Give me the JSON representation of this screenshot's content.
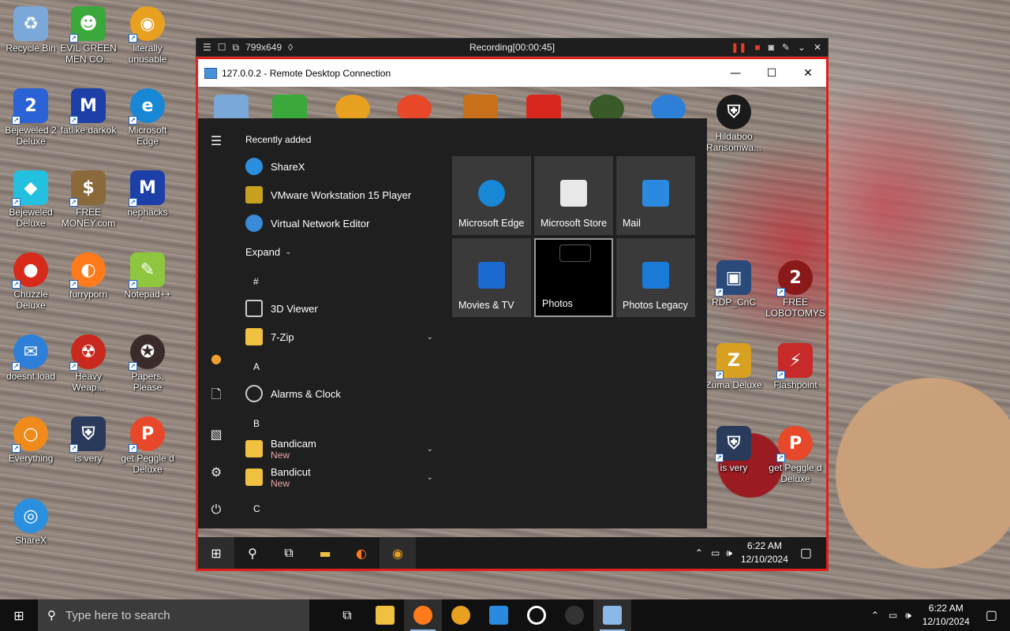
{
  "desktop": {
    "icons": [
      {
        "label": "Recycle Bin",
        "color": "#7aa8d8"
      },
      {
        "label": "EVIL GREEN MEN CO...",
        "color": "#3aa83a"
      },
      {
        "label": "literally unusable",
        "color": "#e8a020"
      },
      {
        "label": "Bejeweled 2 Deluxe",
        "color": "#2b62d6"
      },
      {
        "label": "fatlike darkok",
        "color": "#1c3fa8"
      },
      {
        "label": "Microsoft Edge",
        "color": "#1787d6"
      },
      {
        "label": "Bejeweled Deluxe",
        "color": "#23c0e0"
      },
      {
        "label": "FREE MONEY.com",
        "color": "#8a6a3a"
      },
      {
        "label": "nephacks",
        "color": "#1c3fa8"
      },
      {
        "label": "Chuzzle Deluxe",
        "color": "#d82a1a"
      },
      {
        "label": "furryporn",
        "color": "#ff7a1a"
      },
      {
        "label": "Notepad++",
        "color": "#8ec63f"
      },
      {
        "label": "doesnt load",
        "color": "#2d7fd8"
      },
      {
        "label": "Heavy Weap...",
        "color": "#c8281e"
      },
      {
        "label": "Papers, Please",
        "color": "#3a2a2a"
      },
      {
        "label": "Everything",
        "color": "#f08a1a"
      },
      {
        "label": "is very",
        "color": "#2a3a5a"
      },
      {
        "label": "get Peggle d Deluxe",
        "color": "#e8482a"
      },
      {
        "label": "ShareX",
        "color": "#2b8fe0"
      }
    ]
  },
  "recorder": {
    "size_label": "799x649",
    "status": "Recording[00:00:45]"
  },
  "rdp": {
    "window_title": "127.0.0.2 - Remote Desktop Connection",
    "minimize_glyph": "—",
    "maximize_glyph": "☐",
    "close_glyph": "✕",
    "desktop_icons": [
      {
        "label": "Hildaboo Ransomwa...",
        "color": "#1a1a1a"
      },
      {
        "label": "RDP_CnC",
        "color": "#2a4a7a"
      },
      {
        "label": "FREE LOBOTOMYS",
        "color": "#8a1a1a"
      },
      {
        "label": "Zuma Deluxe",
        "color": "#d8a020"
      },
      {
        "label": "Flashpoint",
        "color": "#c82a2a"
      },
      {
        "label": "is very",
        "color": "#2a3a5a"
      },
      {
        "label": "get Peggle d Deluxe",
        "color": "#e8482a"
      }
    ]
  },
  "start_menu": {
    "recently_added_label": "Recently added",
    "recent": [
      {
        "label": "ShareX",
        "color": "#2b8fe0"
      },
      {
        "label": "VMware Workstation 15 Player",
        "color": "#c8a020"
      },
      {
        "label": "Virtual Network Editor",
        "color": "#3a8ad8"
      }
    ],
    "expand_label": "Expand",
    "groups": [
      {
        "letter": "#",
        "items": [
          {
            "label": "3D Viewer",
            "color": "#555555",
            "new": "",
            "chevron": ""
          },
          {
            "label": "7-Zip",
            "color": "#f0c040",
            "new": "",
            "chevron": "⌄"
          }
        ]
      },
      {
        "letter": "A",
        "items": [
          {
            "label": "Alarms & Clock",
            "color": "#555555",
            "new": "",
            "chevron": ""
          }
        ]
      },
      {
        "letter": "B",
        "items": [
          {
            "label": "Bandicam",
            "color": "#f0c040",
            "new": "New",
            "chevron": "⌄"
          },
          {
            "label": "Bandicut",
            "color": "#f0c040",
            "new": "New",
            "chevron": "⌄"
          }
        ]
      },
      {
        "letter": "C",
        "items": []
      }
    ],
    "tiles": [
      {
        "label": "Microsoft Edge",
        "color": "#1787d6"
      },
      {
        "label": "Microsoft Store",
        "color": "#e8e8e8"
      },
      {
        "label": "Mail",
        "color": "#2a8ae0"
      },
      {
        "label": "Movies & TV",
        "color": "#1a6ad0"
      },
      {
        "label": "Photos",
        "color": "#000000"
      },
      {
        "label": "Photos Legacy",
        "color": "#1a7ad8"
      }
    ],
    "rail": {
      "menu_icon": "☰",
      "user_icon": "●",
      "documents_icon": "🗋",
      "pictures_icon": "▧",
      "settings_icon": "⚙",
      "power_icon": "⏻"
    }
  },
  "rdp_taskbar": {
    "time": "6:22 AM",
    "date": "12/10/2024"
  },
  "host_taskbar": {
    "search_placeholder": "Type here to search",
    "time": "6:22 AM",
    "date": "12/10/2024"
  }
}
